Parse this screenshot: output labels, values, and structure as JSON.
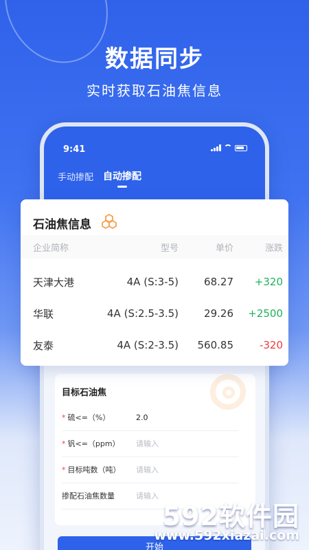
{
  "hero": {
    "title": "数据同步",
    "subtitle": "实时获取石油焦信息"
  },
  "phone": {
    "status_time": "9:41",
    "tabs": [
      {
        "label": "手动掺配",
        "active": false
      },
      {
        "label": "自动掺配",
        "active": true
      }
    ],
    "form": {
      "title": "目标石油焦",
      "rows": [
        {
          "label": "硫<=（%）",
          "required": true,
          "value": "2.0",
          "placeholder": ""
        },
        {
          "label": "钒<=（ppm）",
          "required": true,
          "value": "",
          "placeholder": "请输入"
        },
        {
          "label": "目标吨数（吨）",
          "required": true,
          "value": "",
          "placeholder": "请输入"
        },
        {
          "label": "掺配石油焦数量",
          "required": false,
          "value": "",
          "placeholder": "请输入"
        }
      ]
    },
    "start_button": "开始"
  },
  "info_card": {
    "title": "石油焦信息",
    "icon": "hexagon-cluster-icon",
    "columns": [
      "企业简称",
      "型号",
      "单价",
      "涨跌"
    ],
    "rows": [
      {
        "company": "天津大港",
        "model": "4A (S:3-5)",
        "price": "68.27",
        "change": "+320",
        "trend": "up"
      },
      {
        "company": "华联",
        "model": "4A (S:2.5-3.5)",
        "price": "29.26",
        "change": "+2500",
        "trend": "up"
      },
      {
        "company": "友泰",
        "model": "4A (S:2-3.5)",
        "price": "560.85",
        "change": "-320",
        "trend": "down"
      }
    ]
  },
  "watermark": {
    "main": "592软件园",
    "url": "www.592xiazai.com"
  },
  "colors": {
    "brand_blue": "#2e62ea",
    "up_green": "#20b15a",
    "down_red": "#ee3b3b",
    "accent_orange": "#f5a050"
  }
}
